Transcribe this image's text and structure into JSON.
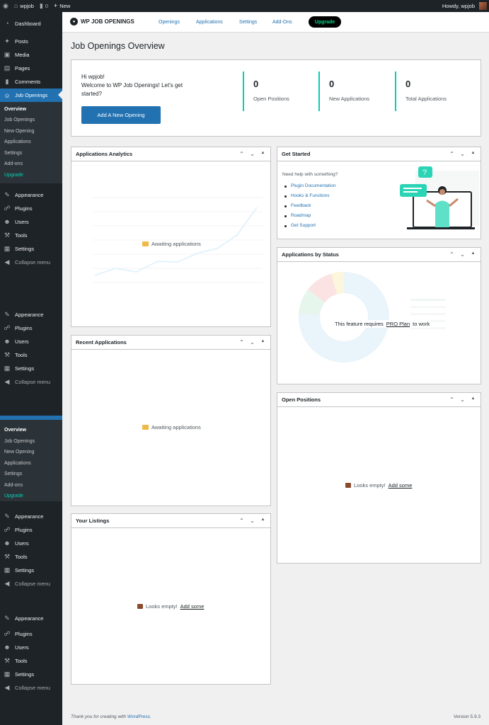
{
  "adminbar": {
    "site_name": "wpjob",
    "comments_count": "0",
    "new_label": "New",
    "howdy": "Howdy, wpjob"
  },
  "sidebar": {
    "dashboard": "Dashboard",
    "posts": "Posts",
    "media": "Media",
    "pages": "Pages",
    "comments": "Comments",
    "job_openings": "Job Openings",
    "submenu": [
      "Overview",
      "Job Openings",
      "New Opening",
      "Applications",
      "Settings",
      "Add-ons",
      "Upgrade"
    ],
    "appearance": "Appearance",
    "plugins": "Plugins",
    "users": "Users",
    "tools": "Tools",
    "settings": "Settings",
    "collapse": "Collapse menu"
  },
  "topnav": {
    "brand": "WP JOB OPENINGS",
    "links": [
      "Openings",
      "Applications",
      "Settings",
      "Add-Ons"
    ],
    "upgrade": "Upgrade"
  },
  "page_title": "Job Openings Overview",
  "welcome": {
    "greeting": "Hi wpjob!",
    "message": "Welcome to WP Job Openings! Let's get started?",
    "button": "Add A New Opening"
  },
  "stats": [
    {
      "value": "0",
      "label": "Open Positions"
    },
    {
      "value": "0",
      "label": "New Applications"
    },
    {
      "value": "0",
      "label": "Total Applications"
    }
  ],
  "panels": {
    "analytics": {
      "title": "Applications Analytics",
      "empty": "Awaiting applications"
    },
    "recent": {
      "title": "Recent Applications",
      "empty": "Awaiting applications"
    },
    "listings": {
      "title": "Your Listings",
      "empty": "Looks empty!",
      "link": "Add some"
    },
    "get_started": {
      "title": "Get Started",
      "intro": "Need help with something?",
      "links": [
        "Plugin Documentation",
        "Hooks & Functions",
        "Feedback",
        "Roadmap",
        "Get Support"
      ]
    },
    "status": {
      "title": "Applications by Status",
      "msg_pre": "This feature requires",
      "msg_link": "PRO Plan",
      "msg_post": "to work"
    },
    "open_positions": {
      "title": "Open Positions",
      "empty": "Looks empty!",
      "link": "Add some"
    }
  },
  "footer": {
    "thanks": "Thank you for creating with",
    "wp_link": "WordPress",
    "version": "Version 5.9.3"
  },
  "colors": {
    "accent": "#2271b1",
    "teal": "#00d2b4",
    "sidebar": "#1d2327",
    "upgrade_text": "#00d084"
  }
}
